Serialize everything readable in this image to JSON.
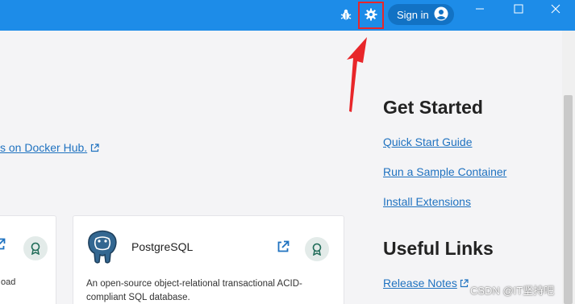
{
  "titlebar": {
    "sign_in_label": "Sign in",
    "icons": [
      "bug-icon",
      "gear-icon",
      "account-icon",
      "minimize-icon",
      "maximize-icon",
      "close-icon"
    ],
    "background": "#1d8ce8"
  },
  "main": {
    "docker_hub_link": "s on Docker Hub.",
    "cards": [
      {
        "desc_fragment": "oad"
      },
      {
        "title": "PostgreSQL",
        "description": "An open-source object-relational transactional ACID-compliant SQL database."
      }
    ]
  },
  "sidebar": {
    "get_started": {
      "heading": "Get Started",
      "links": [
        "Quick Start Guide",
        "Run a Sample Container",
        "Install Extensions"
      ]
    },
    "useful_links": {
      "heading": "Useful Links",
      "links": [
        "Release Notes"
      ]
    }
  },
  "annotation": {
    "color": "#e8262a"
  },
  "watermark": "CSDN @IT坚持吧"
}
